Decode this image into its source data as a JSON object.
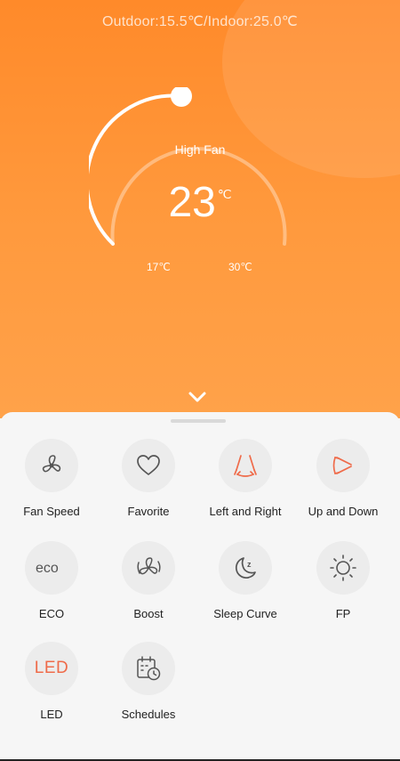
{
  "header": {
    "outdoor_indoor": "Outdoor:15.5℃/Indoor:25.0℃"
  },
  "dial": {
    "mode": "High Fan",
    "setpoint": "23",
    "unit": "℃",
    "min_label": "17℃",
    "max_label": "30℃"
  },
  "controls": [
    {
      "label": "Fan Speed",
      "icon": "fan-icon"
    },
    {
      "label": "Favorite",
      "icon": "heart-icon"
    },
    {
      "label": "Left and Right",
      "icon": "swing-left-right-icon"
    },
    {
      "label": "Up and Down",
      "icon": "swing-up-down-icon"
    },
    {
      "label": "ECO",
      "icon": "eco-icon"
    },
    {
      "label": "Boost",
      "icon": "boost-icon"
    },
    {
      "label": "Sleep Curve",
      "icon": "moon-icon"
    },
    {
      "label": "FP",
      "icon": "sun-icon"
    },
    {
      "label": "LED",
      "icon": "led-icon",
      "text": "LED"
    },
    {
      "label": "Schedules",
      "icon": "calendar-clock-icon"
    }
  ],
  "colors": {
    "accent_orange": "#ff8a2a",
    "active_red": "#ef6b4a",
    "icon_gray": "#555555"
  }
}
